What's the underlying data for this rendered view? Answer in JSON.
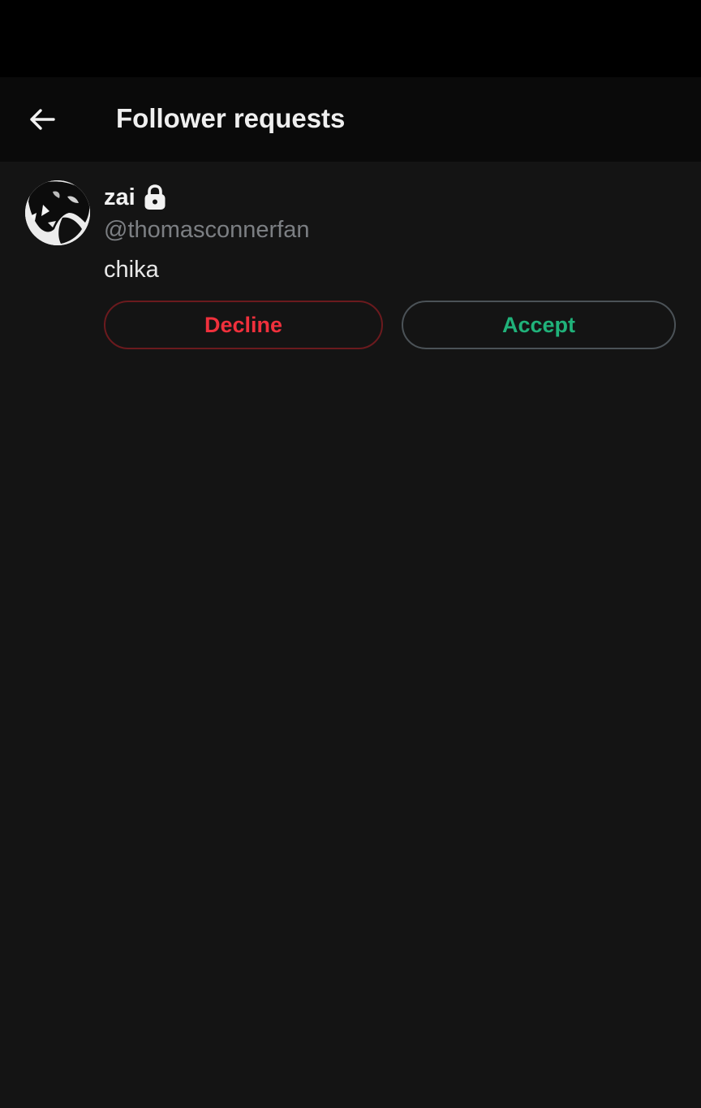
{
  "header": {
    "title": "Follower requests",
    "back_icon": "arrow-left-icon"
  },
  "requests": [
    {
      "display_name": "zai",
      "handle": "@thomasconnerfan",
      "bio": "chika",
      "protected_icon": "lock-icon",
      "decline_label": "Decline",
      "accept_label": "Accept"
    }
  ],
  "colors": {
    "background": "#141414",
    "decline": "#f0303c",
    "accept": "#20b27a",
    "handle": "#7c7f83"
  }
}
